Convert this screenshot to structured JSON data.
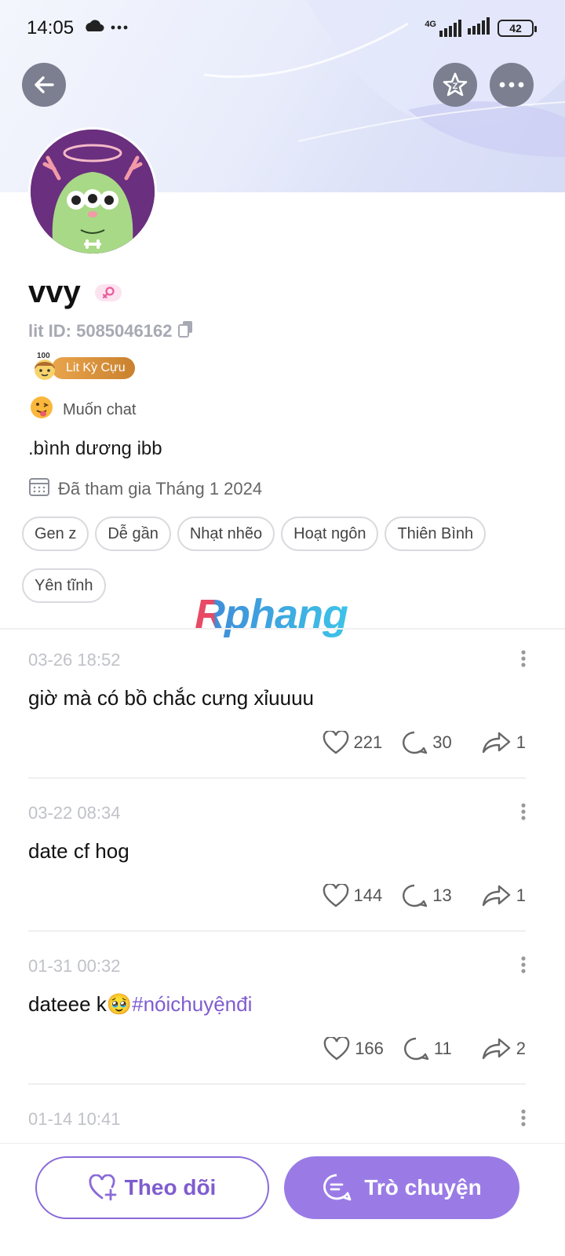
{
  "status_bar": {
    "time": "14:05",
    "network_label": "4G",
    "battery": "42"
  },
  "header": {
    "back_icon": "arrow-left-icon",
    "favorite_icon": "star-icon",
    "more_icon": "more-dots-icon"
  },
  "profile": {
    "name": "vvy",
    "lit_id": "lit ID: 5085046162",
    "badge_number": "100",
    "badge_label": "Lit Kỳ Cựu",
    "mood": "Muốn chat",
    "bio": ".bình dương ibb",
    "joined": "Đã tham gia Tháng 1 2024",
    "tags": [
      "Gen z",
      "Dễ gần",
      "Nhạt nhẽo",
      "Hoạt ngôn",
      "Thiên Bình",
      "Yên tĩnh"
    ]
  },
  "watermark": "Rphang",
  "posts": [
    {
      "time": "03-26 18:52",
      "text": "giờ mà có bồ chắc cưng xỉuuuu",
      "emoji": "",
      "hashtag": "",
      "likes": "221",
      "comments": "30",
      "shares": "1"
    },
    {
      "time": "03-22 08:34",
      "text": "date cf hog",
      "emoji": "",
      "hashtag": "",
      "likes": "144",
      "comments": "13",
      "shares": "1"
    },
    {
      "time": "01-31 00:32",
      "text": "dateee k",
      "emoji": "🥹",
      "hashtag": "#nóichuyệnđi",
      "likes": "166",
      "comments": "11",
      "shares": "2"
    },
    {
      "time": "01-14 10:41"
    }
  ],
  "bottom": {
    "follow_label": "Theo dõi",
    "chat_label": "Trò chuyện"
  },
  "colors": {
    "accent": "#9a7be6",
    "hashtag": "#7f5ccf",
    "veteran_badge": "#d18f3a"
  }
}
